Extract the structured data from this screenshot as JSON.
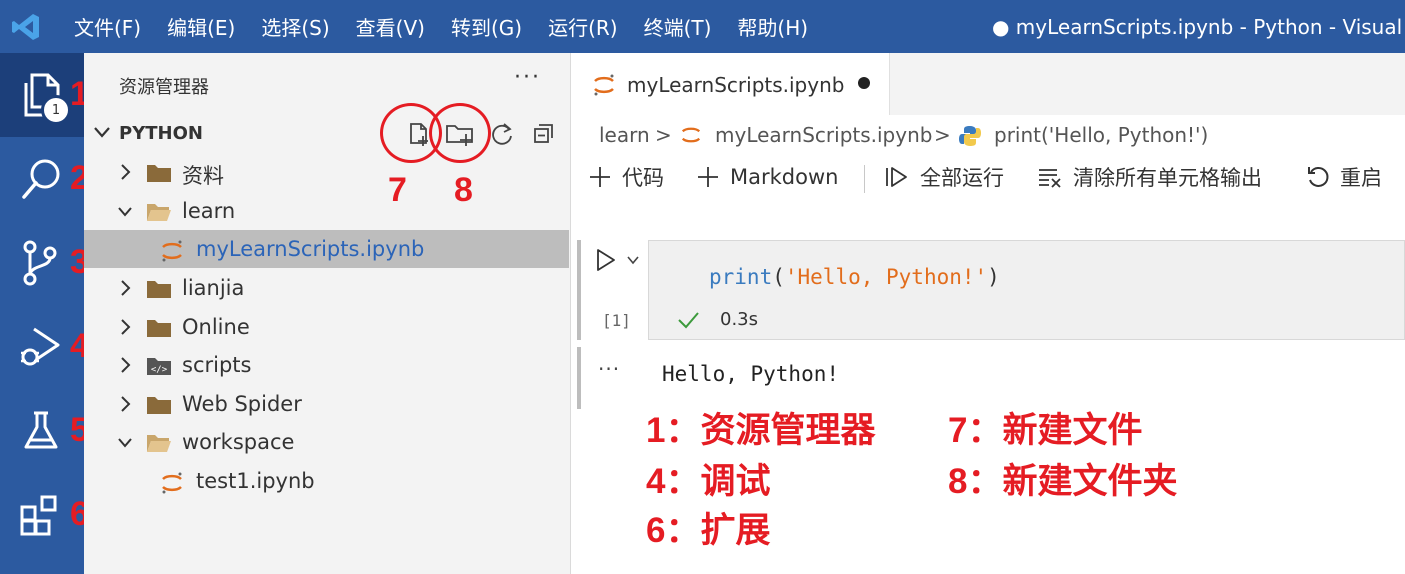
{
  "titlebar": {
    "menu": [
      "文件(F)",
      "编辑(E)",
      "选择(S)",
      "查看(V)",
      "转到(G)",
      "运行(R)",
      "终端(T)",
      "帮助(H)"
    ],
    "window_title": "● myLearnScripts.ipynb - Python - Visual Stud"
  },
  "activity_bar": {
    "items": [
      {
        "icon": "explorer-icon",
        "number": "1",
        "active": true,
        "badge": "1"
      },
      {
        "icon": "search-icon",
        "number": "2"
      },
      {
        "icon": "source-control-icon",
        "number": "3"
      },
      {
        "icon": "run-debug-icon",
        "number": "4"
      },
      {
        "icon": "testing-flask-icon",
        "number": "5"
      },
      {
        "icon": "extensions-icon",
        "number": "6"
      }
    ]
  },
  "sidebar": {
    "title": "资源管理器",
    "more": "···",
    "section_title": "PYTHON",
    "actions": [
      "new-file-icon",
      "new-folder-icon",
      "refresh-icon",
      "collapse-all-icon"
    ],
    "annotations": {
      "new_file": "7",
      "new_folder": "8"
    },
    "tree": [
      {
        "label": "资料",
        "type": "folder",
        "expanded": false
      },
      {
        "label": "learn",
        "type": "folder",
        "expanded": true
      },
      {
        "label": "myLearnScripts.ipynb",
        "type": "notebook",
        "selected": true
      },
      {
        "label": "lianjia",
        "type": "folder",
        "expanded": false
      },
      {
        "label": "Online",
        "type": "folder",
        "expanded": false
      },
      {
        "label": "scripts",
        "type": "folder-code",
        "expanded": false
      },
      {
        "label": "Web Spider",
        "type": "folder",
        "expanded": false
      },
      {
        "label": "workspace",
        "type": "folder",
        "expanded": true
      },
      {
        "label": "test1.ipynb",
        "type": "notebook"
      }
    ]
  },
  "editor": {
    "tab": {
      "label": "myLearnScripts.ipynb",
      "dirty": true
    },
    "breadcrumb": {
      "folder": "learn",
      "sep1": ">",
      "file": "myLearnScripts.ipynb",
      "sep2": ">",
      "symbol": "print('Hello, Python!')"
    },
    "toolbar": {
      "code": "代码",
      "markdown": "Markdown",
      "run_all": "全部运行",
      "clear_outputs": "清除所有单元格输出",
      "restart": "重启"
    },
    "cell": {
      "code": {
        "fn": "print",
        "open": "(",
        "str": "'Hello, Python!'",
        "close": ")"
      },
      "exec_count": "[1]",
      "exec_time": "0.3s",
      "output_dots": "···",
      "output": "Hello, Python!"
    }
  },
  "legend": {
    "item1": "1：资源管理器",
    "item4": "4：调试",
    "item6": "6：扩展",
    "item7": "7：新建文件",
    "item8": "8：新建文件夹"
  },
  "colors": {
    "titlebar": "#2c5aa0",
    "activity_active": "#1c3f7a",
    "annotation_red": "#e51c23",
    "notebook_orange": "#e26d1c",
    "folder_brown": "#8a6a3a"
  }
}
